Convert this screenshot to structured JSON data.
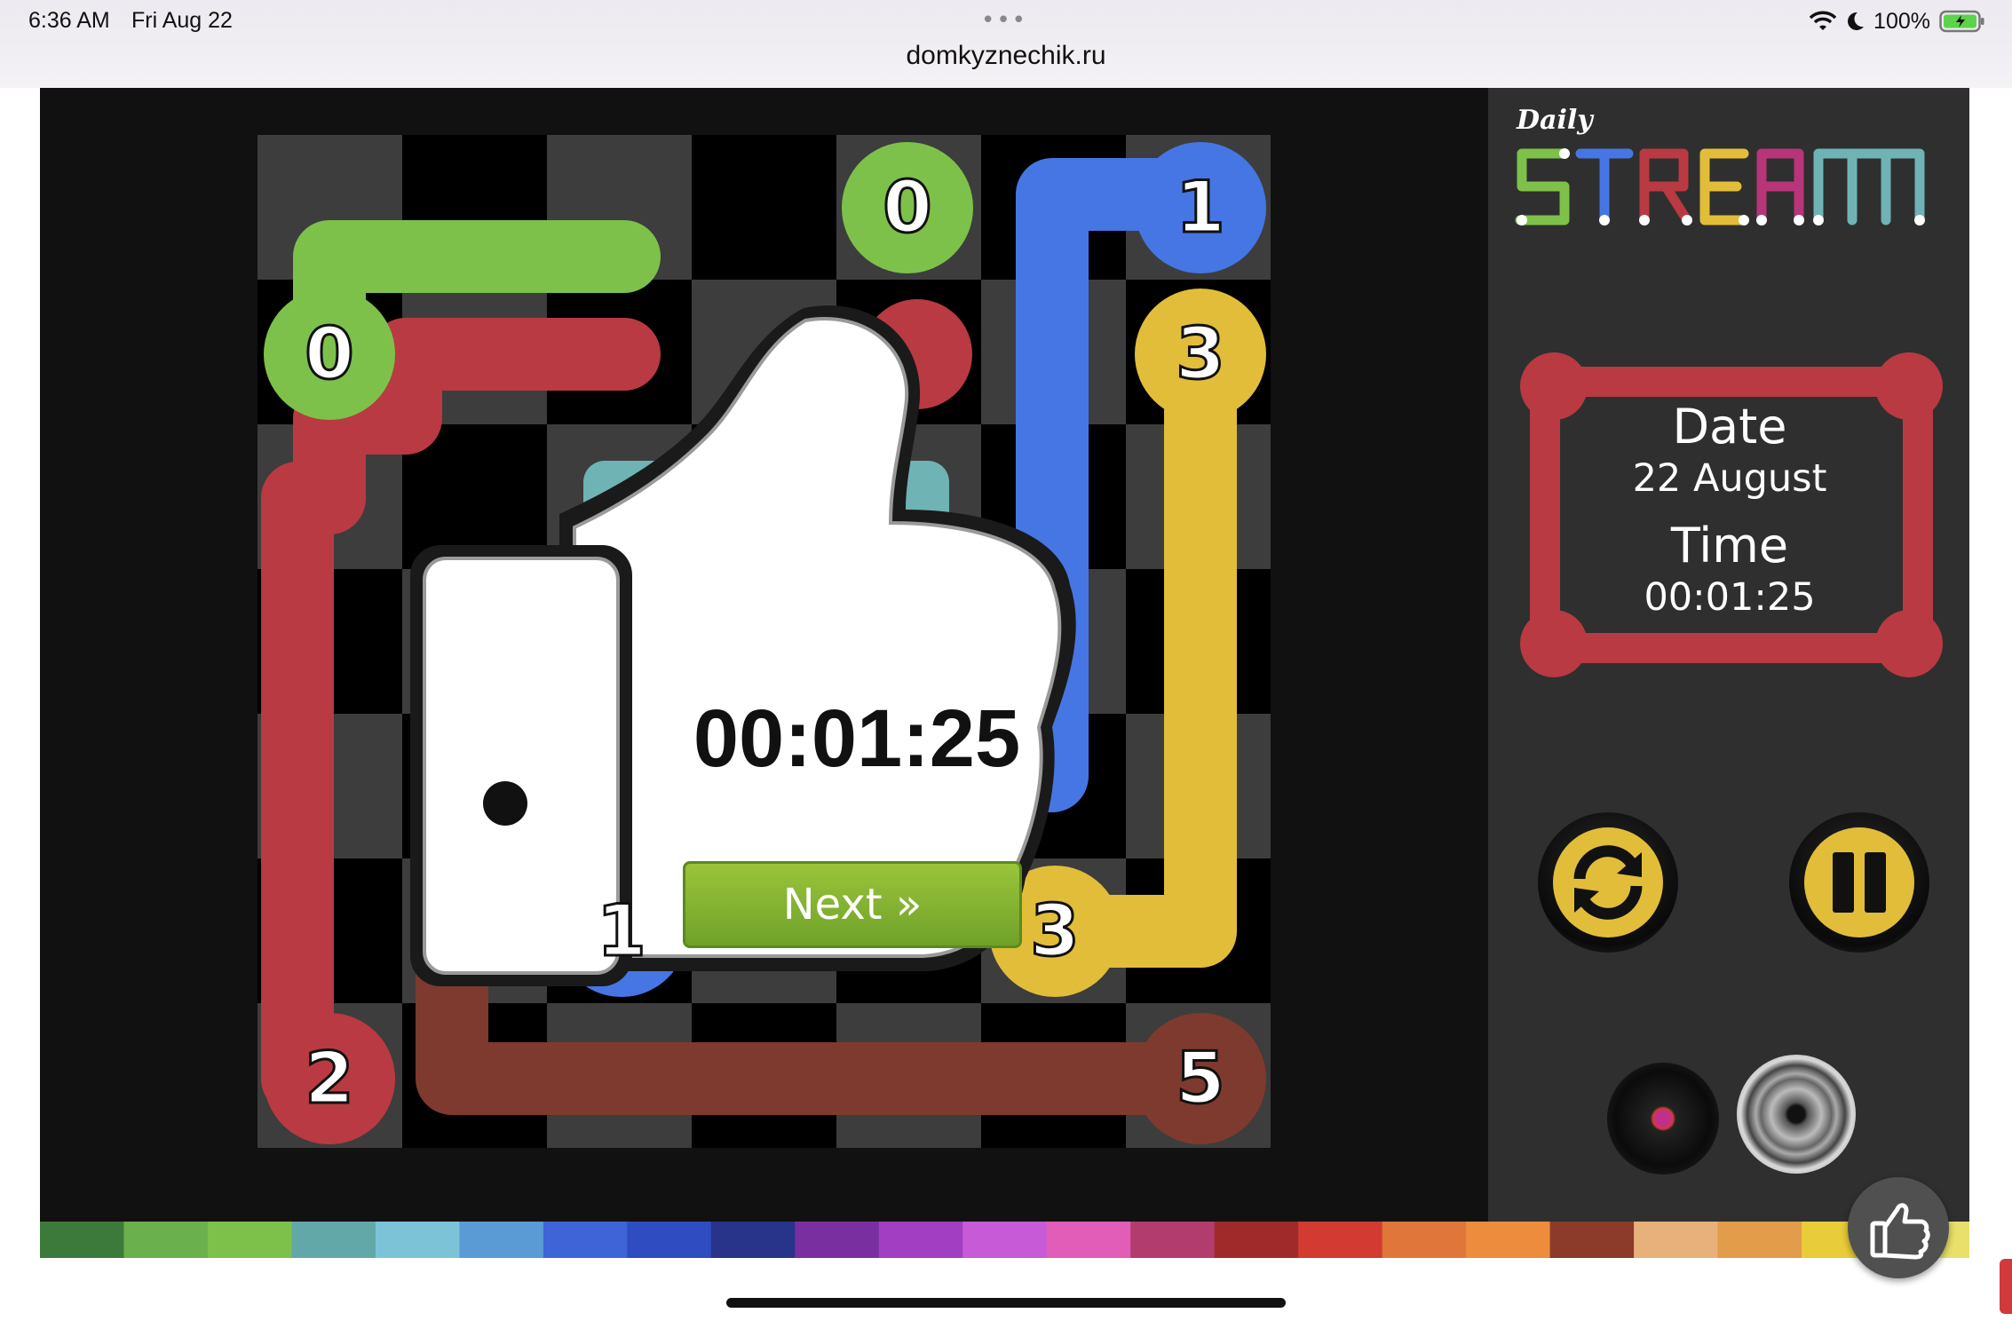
{
  "status_bar": {
    "time": "6:36 AM",
    "date": "Fri Aug 22",
    "url": "domkyznechik.ru",
    "battery": "100%",
    "icons": [
      "wifi-icon",
      "moon-icon",
      "battery-icon"
    ]
  },
  "logo": {
    "daily": "Daily",
    "title": "STREAM"
  },
  "info": {
    "date_label": "Date",
    "date_value": "22 August",
    "time_label": "Time",
    "time_value": "00:01:25"
  },
  "win_popup": {
    "timer": "00:01:25",
    "next_label": "Next »"
  },
  "board": {
    "grid_size": 7,
    "nodes": [
      {
        "label": "0",
        "color": "#7dc14a",
        "row": 0,
        "col": 4
      },
      {
        "label": "0",
        "color": "#7dc14a",
        "row": 1,
        "col": 0
      },
      {
        "label": "1",
        "color": "#4676e3",
        "row": 0,
        "col": 6
      },
      {
        "label": "1",
        "color": "#4676e3",
        "row": 5,
        "col": 2
      },
      {
        "label": "2",
        "color": "#b93a42",
        "row": 7,
        "col": 0
      },
      {
        "label": "3",
        "color": "#e1bd3a",
        "row": 1,
        "col": 6
      },
      {
        "label": "3",
        "color": "#e1bd3a",
        "row": 5,
        "col": 5
      },
      {
        "label": "5",
        "color": "#7e3a2e",
        "row": 7,
        "col": 6
      }
    ]
  },
  "colors": {
    "green": "#7dc14a",
    "blue": "#4676e3",
    "red": "#b93a42",
    "yellow": "#e1bd3a",
    "brown": "#7e3a2e",
    "teal": "#6fb3b5",
    "sidebar": "#2f2f2f",
    "next_green": "#7fb236"
  },
  "controls": [
    "restart-button",
    "pause-button",
    "record-button",
    "sound-button",
    "like-button"
  ]
}
